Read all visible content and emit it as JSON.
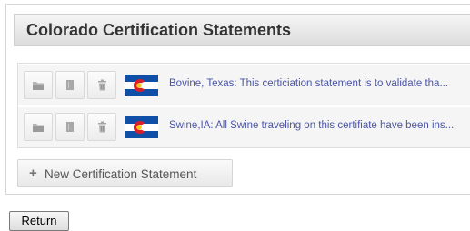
{
  "panel": {
    "title": "Colorado Certification Statements"
  },
  "statements": [
    {
      "text": "Bovine, Texas: This certiciation statement is to validate tha...",
      "flag": "colorado-flag-icon",
      "actions": [
        "folder-icon",
        "document-icon",
        "trash-icon"
      ]
    },
    {
      "text": "Swine,IA: All Swine traveling on this certifiate have been ins...",
      "flag": "colorado-flag-icon",
      "actions": [
        "folder-icon",
        "document-icon",
        "trash-icon"
      ]
    }
  ],
  "new_button": {
    "icon": "plus-icon",
    "label": "New Certification Statement"
  },
  "return_button": {
    "label": "Return"
  },
  "colors": {
    "flag_blue": "#0f4fa8",
    "flag_red": "#d61f26",
    "flag_gold": "#f5c518",
    "link_text": "#4a55a6"
  }
}
